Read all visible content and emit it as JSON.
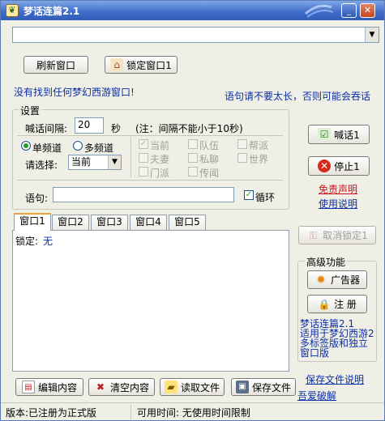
{
  "window": {
    "title": "梦话连篇2.1"
  },
  "titlebar": {
    "min_glyph": "_",
    "close_glyph": "✕"
  },
  "top": {
    "refresh_label": "刷新窗口",
    "lock_label": "锁定窗口1",
    "no_window_msg": "没有找到任何梦幻西游窗口!",
    "length_tip": "语句请不要太长，否则可能会吞话"
  },
  "settings": {
    "title": "设置",
    "interval_label": "喊话间隔:",
    "interval_value": "20",
    "interval_unit": "秒",
    "interval_note": "(注：间隔不能小于10秒)",
    "single_channel": "单频道",
    "multi_channel": "多频道",
    "choose_label": "请选择:",
    "channel_selected": "当前",
    "channels": [
      "当前",
      "队伍",
      "帮派",
      "夫妻",
      "私聊",
      "世界",
      "门派",
      "传闻"
    ],
    "phrase_label": "语句:",
    "phrase_value": "",
    "loop_label": "循环"
  },
  "right": {
    "shout_label": "喊话1",
    "stop_label": "停止1",
    "disclaimer": "免责声明",
    "manual": "使用说明",
    "unlock_label": "取消锁定1",
    "advanced_title": "高级功能",
    "ad_label": "广告器",
    "register_label": "注  册",
    "info_line1": "梦话连篇2.1",
    "info_line2": "适用于梦幻西游2",
    "info_line3": "多标签版和独立",
    "info_line4": "窗口版",
    "save_file_doc": "保存文件说明",
    "crack_link": "吾爱破解"
  },
  "tabs": [
    "窗口1",
    "窗口2",
    "窗口3",
    "窗口4",
    "窗口5"
  ],
  "panel": {
    "lock_label": "锁定:",
    "lock_value": "无"
  },
  "bottom": {
    "edit_label": "编辑内容",
    "clear_label": "清空内容",
    "read_label": "读取文件",
    "save_label": "保存文件"
  },
  "status": {
    "version": "版本:已注册为正式版",
    "time": "可用时间: 无使用时间限制"
  }
}
